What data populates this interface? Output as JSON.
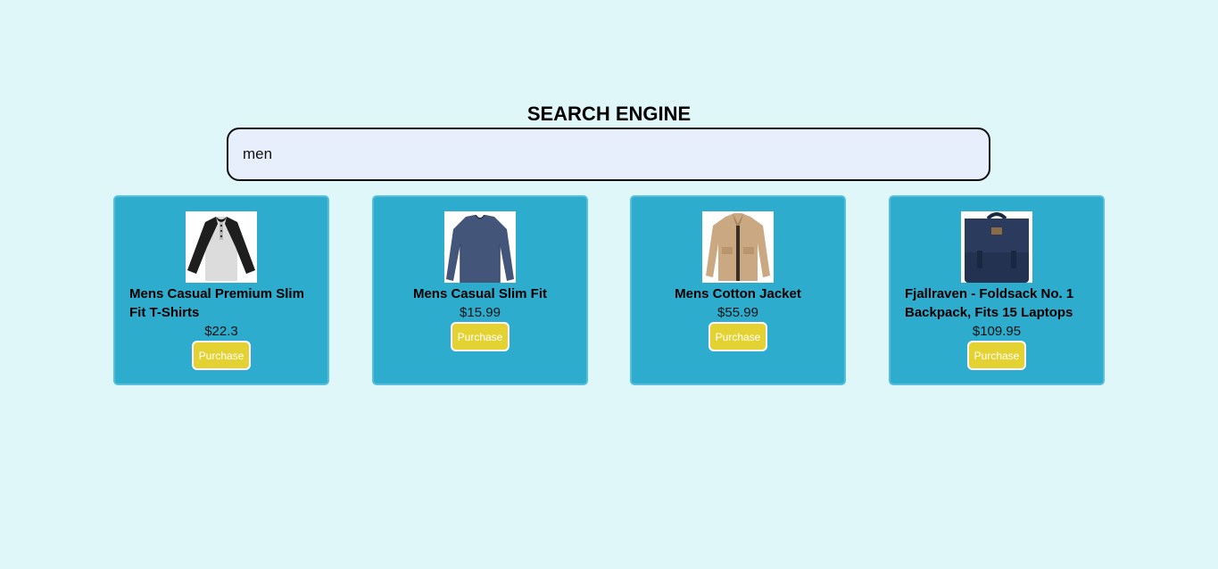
{
  "page": {
    "title": "SEARCH ENGINE"
  },
  "search": {
    "value": "men"
  },
  "products": [
    {
      "name": "Mens Casual Premium Slim Fit T-Shirts",
      "price": "$22.3",
      "button": "Purchase",
      "image_icon": "raglan-tshirt-image"
    },
    {
      "name": "Mens Casual Slim Fit",
      "price": "$15.99",
      "button": "Purchase",
      "image_icon": "long-sleeve-shirt-image"
    },
    {
      "name": "Mens Cotton Jacket",
      "price": "$55.99",
      "button": "Purchase",
      "image_icon": "cotton-jacket-image"
    },
    {
      "name": "Fjallraven - Foldsack No. 1 Backpack, Fits 15 Laptops",
      "price": "$109.95",
      "button": "Purchase",
      "image_icon": "backpack-image"
    }
  ],
  "colors": {
    "background": "#e0f7f9",
    "card": "#2eacce",
    "button": "#e3d232",
    "search_field": "#e8effc"
  }
}
